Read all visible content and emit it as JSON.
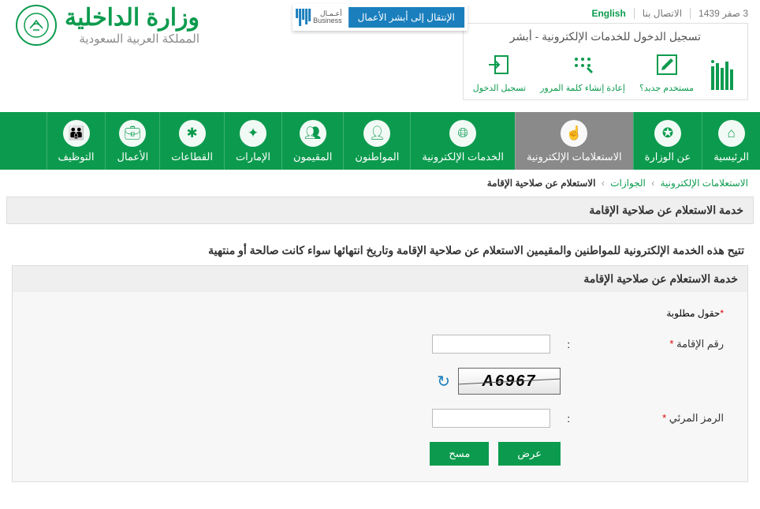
{
  "header": {
    "brand_title": "وزارة الداخلية",
    "brand_sub": "المملكة العربية السعودية",
    "date_hijri": "3 صفر 1439",
    "contact": "الاتصال بنا",
    "lang": "English",
    "biz_button": "الإنتقال إلى أبشر الأعمال",
    "biz_label_ar": "أعـمـال",
    "biz_label_en": "Business"
  },
  "login": {
    "title": "تسجيل الدخول للخدمات الإلكترونية - أبشر",
    "items": [
      {
        "label": "أبشر",
        "icon": "absher"
      },
      {
        "label": "مستخدم جديد؟",
        "icon": "edit"
      },
      {
        "label": "إعادة إنشاء كلمة المرور",
        "icon": "dots"
      },
      {
        "label": "تسجيل الدخول",
        "icon": "login"
      }
    ]
  },
  "nav": [
    {
      "label": "الرئيسية",
      "icon": "home"
    },
    {
      "label": "عن الوزارة",
      "icon": "emblem"
    },
    {
      "label": "الاستعلامات الإلكترونية",
      "icon": "hand",
      "active": true
    },
    {
      "label": "الخدمات الإلكترونية",
      "icon": "globe"
    },
    {
      "label": "المواطنون",
      "icon": "person"
    },
    {
      "label": "المقيمون",
      "icon": "group"
    },
    {
      "label": "الإمارات",
      "icon": "flag"
    },
    {
      "label": "القطاعات",
      "icon": "share"
    },
    {
      "label": "الأعمال",
      "icon": "briefcase"
    },
    {
      "label": "التوظيف",
      "icon": "team"
    }
  ],
  "breadcrumb": {
    "l1": "الاستعلامات الإلكترونية",
    "l2": "الجوازات",
    "current": "الاستعلام عن صلاحية الإقامة"
  },
  "page": {
    "panel1_title": "خدمة الاستعلام عن صلاحية الإقامة",
    "description": "تتيح هذه الخدمة الإلكترونية للمواطنين والمقيمين الاستعلام عن صلاحية الإقامة وتاريخ انتهائها سواء كانت صالحة أو منتهية",
    "form_title": "خدمة الاستعلام عن صلاحية الإقامة",
    "required_label": "حقول مطلوبة",
    "field_iqama": "رقم الإقامة",
    "field_captcha": "الرمز المرئي",
    "captcha_value": "A6967",
    "btn_submit": "عرض",
    "btn_clear": "مسح"
  }
}
